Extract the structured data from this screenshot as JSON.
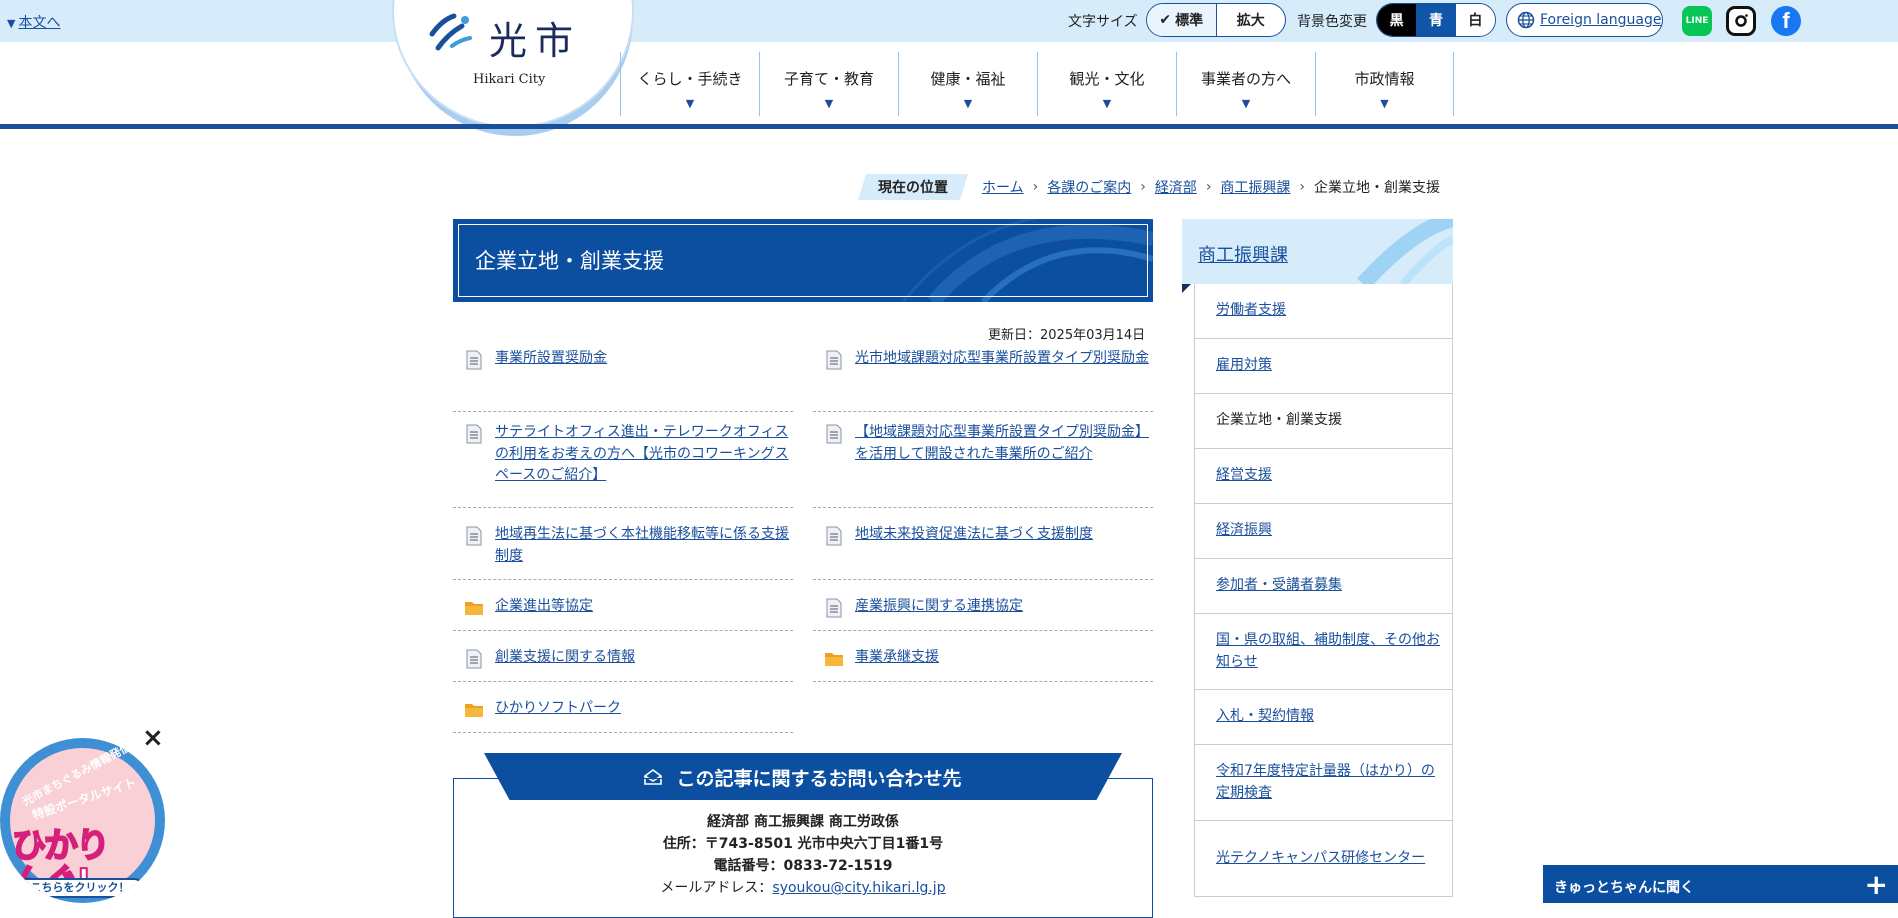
{
  "header": {
    "skip_link": "本文へ",
    "font_size_label": "文字サイズ",
    "font_size_standard": "標準",
    "font_size_large": "拡大",
    "bg_color_label": "背景色変更",
    "bg_black": "黒",
    "bg_blue": "青",
    "bg_white": "白",
    "foreign_language": "Foreign language",
    "logo_name": "光市",
    "logo_en": "Hikari City",
    "sns": [
      "line-icon",
      "instagram-icon",
      "facebook-icon"
    ]
  },
  "gnav": [
    {
      "label": "くらし・手続き"
    },
    {
      "label": "子育て・教育"
    },
    {
      "label": "健康・福祉"
    },
    {
      "label": "観光・文化"
    },
    {
      "label": "事業者の方へ"
    },
    {
      "label": "市政情報"
    }
  ],
  "breadcrumb": {
    "here_label": "現在の位置",
    "items": [
      "ホーム",
      "各課のご案内",
      "経済部",
      "商工振興課"
    ],
    "current": "企業立地・創業支援",
    "separator": "›"
  },
  "page": {
    "title": "企業立地・創業支援",
    "updated": "更新日：2025年03月14日"
  },
  "links": [
    {
      "text": "事業所設置奨励金",
      "icon": "document-icon"
    },
    {
      "text": "光市地域課題対応型事業所設置タイプ別奨励金",
      "icon": "document-icon"
    },
    {
      "text": "サテライトオフィス進出・テレワークオフィスの利用をお考えの方へ【光市のコワーキングスペースのご紹介】",
      "icon": "document-icon"
    },
    {
      "text": "【地域課題対応型事業所設置タイプ別奨励金】を活用して開設された事業所のご紹介",
      "icon": "document-icon"
    },
    {
      "text": "地域再生法に基づく本社機能移転等に係る支援制度",
      "icon": "document-icon"
    },
    {
      "text": "地域未来投資促進法に基づく支援制度",
      "icon": "document-icon"
    },
    {
      "text": "企業進出等協定",
      "icon": "folder-icon"
    },
    {
      "text": "産業振興に関する連携協定",
      "icon": "document-icon"
    },
    {
      "text": "創業支援に関する情報",
      "icon": "document-icon"
    },
    {
      "text": "事業承継支援",
      "icon": "folder-icon"
    },
    {
      "text": "ひかりソフトパーク",
      "icon": "folder-icon"
    }
  ],
  "contact": {
    "heading": "この記事に関するお問い合わせ先",
    "department": "経済部 商工振興課 商工労政係",
    "address": "住所：〒743-8501 光市中央六丁目1番1号",
    "phone": "電話番号：0833-72-1519",
    "email_label": "メールアドレス：",
    "email": "syoukou@city.hikari.lg.jp"
  },
  "sidebar": {
    "heading": "商工振興課",
    "items": [
      {
        "label": "労働者支援",
        "current": false
      },
      {
        "label": "雇用対策",
        "current": false
      },
      {
        "label": "企業立地・創業支援",
        "current": true
      },
      {
        "label": "経営支援",
        "current": false
      },
      {
        "label": "経済振興",
        "current": false
      },
      {
        "label": "参加者・受講者募集",
        "current": false
      },
      {
        "label": "国・県の取組、補助制度、その他お知らせ",
        "current": false
      },
      {
        "label": "入札・契約情報",
        "current": false
      },
      {
        "label": "令和7年度特定計量器（はかり）の定期検査",
        "current": false
      },
      {
        "label": "光テクノキャンパス研修センター",
        "current": false
      }
    ]
  },
  "banner": {
    "line1": "光市まちぐるみ情報発信",
    "line2": "特設ポータルサイト",
    "title1": "ひかり",
    "title2": "んぐ!",
    "cta": "こちらをクリック！",
    "close": "×"
  },
  "chat": {
    "label": "きゅっとちゃんに聞く",
    "plus": "+"
  },
  "colors": {
    "brand_blue": "#0c4fa1",
    "light_blue": "#d6ecfb",
    "link": "#1a4f9c",
    "folder": "#f0a020"
  }
}
